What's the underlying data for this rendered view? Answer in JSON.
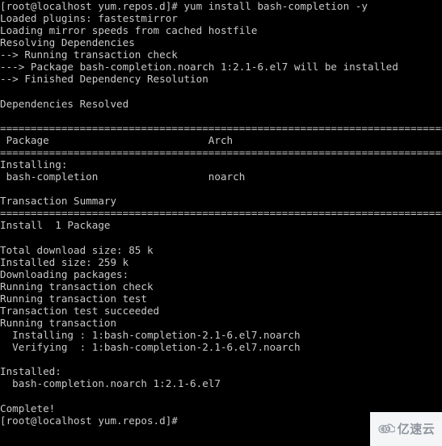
{
  "terminal": {
    "background_color": "#000000",
    "text_color": "#c9c9c9",
    "prompt": "[root@localhost yum.repos.d]#",
    "command": "yum install bash-completion -y",
    "lines": [
      "[root@localhost yum.repos.d]# yum install bash-completion -y",
      "Loaded plugins: fastestmirror",
      "Loading mirror speeds from cached hostfile",
      "Resolving Dependencies",
      "--> Running transaction check",
      "---> Package bash-completion.noarch 1:2.1-6.el7 will be installed",
      "--> Finished Dependency Resolution",
      "",
      "Dependencies Resolved",
      "",
      "================================================================================",
      " Package                          Arch",
      "================================================================================",
      "Installing:",
      " bash-completion                  noarch",
      "",
      "Transaction Summary",
      "================================================================================",
      "Install  1 Package",
      "",
      "Total download size: 85 k",
      "Installed size: 259 k",
      "Downloading packages:",
      "Running transaction check",
      "Running transaction test",
      "Transaction test succeeded",
      "Running transaction",
      "  Installing : 1:bash-completion-2.1-6.el7.noarch",
      "  Verifying  : 1:bash-completion-2.1-6.el7.noarch",
      "",
      "Installed:",
      "  bash-completion.noarch 1:2.1-6.el7",
      "",
      "Complete!",
      "[root@localhost yum.repos.d]#"
    ]
  },
  "table": {
    "headers": [
      "Package",
      "Arch"
    ],
    "sections": [
      {
        "label": "Installing:",
        "rows": [
          {
            "package": "bash-completion",
            "arch": "noarch"
          }
        ]
      }
    ]
  },
  "summary": {
    "title": "Transaction Summary",
    "install_line": "Install  1 Package",
    "total_download_size": "85 k",
    "installed_size": "259 k",
    "installed_package": "bash-completion.noarch 1:2.1-6.el7",
    "status": "Complete!"
  },
  "watermark": {
    "text": "亿速云",
    "logo_name": "cloud-logo-icon",
    "background_color": "#f4f5f7",
    "text_color": "#8e959e"
  }
}
